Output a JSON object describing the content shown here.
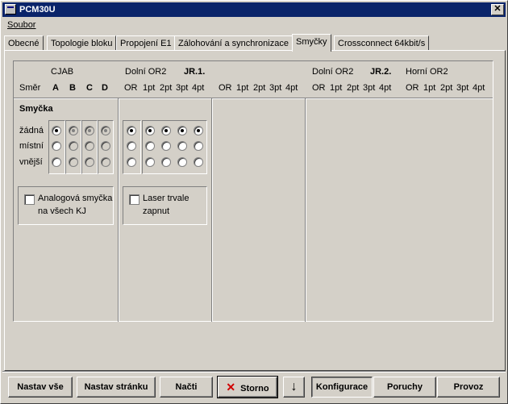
{
  "window": {
    "title": "PCM30U"
  },
  "menu": {
    "soubor": "Soubor"
  },
  "tabs": [
    "Obecné",
    "Topologie bloku",
    "Propojení E1",
    "Zálohování a synchronizace",
    "Smyčky",
    "Crossconnect 64kbit/s"
  ],
  "active_tab": "Smyčky",
  "header": {
    "cjab": "CJAB",
    "smer": "Směr",
    "abcd": [
      "A",
      "B",
      "C",
      "D"
    ],
    "jr1_dolni": "Dolní OR2",
    "jr1_title": "JR.1.",
    "jr1_cols": [
      "OR",
      "1pt",
      "2pt",
      "3pt",
      "4pt"
    ],
    "mid_cols": [
      "OR",
      "1pt",
      "2pt",
      "3pt",
      "4pt"
    ],
    "jr2_dolni": "Dolní OR2",
    "jr2_title": "JR.2.",
    "jr2_horni": "Horní OR2",
    "jr2_cols_left": [
      "OR",
      "1pt",
      "2pt",
      "3pt",
      "4pt"
    ],
    "jr2_cols_right": [
      "OR",
      "1pt",
      "2pt",
      "3pt",
      "4pt"
    ]
  },
  "smycka": {
    "title": "Smyčka",
    "rows": [
      "žádná",
      "místní",
      "vnější"
    ],
    "cjab_selected": [
      0,
      0,
      0,
      0
    ],
    "cjab_disabled": [
      false,
      true,
      true,
      true
    ],
    "jr1_selected": [
      0,
      0,
      0,
      0,
      0
    ]
  },
  "checkboxes": {
    "analog_line1": "Analogová smyčka",
    "analog_line2": "na všech KJ",
    "analog_checked": false,
    "laser_line1": "Laser trvale",
    "laser_line2": "zapnut",
    "laser_checked": false
  },
  "buttons": {
    "nastav_vse": "Nastav vše",
    "nastav_stranku": "Nastav stránku",
    "nacti": "Načti",
    "storno": "Storno",
    "arrow": "↓",
    "konfigurace": "Konfigurace",
    "poruchy": "Poruchy",
    "provoz": "Provoz"
  }
}
